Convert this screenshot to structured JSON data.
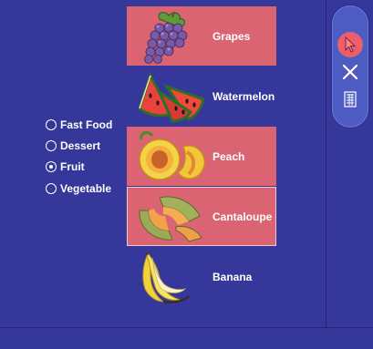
{
  "categories": [
    {
      "label": "Fast Food",
      "checked": false
    },
    {
      "label": "Dessert",
      "checked": false
    },
    {
      "label": "Fruit",
      "checked": true
    },
    {
      "label": "Vegetable",
      "checked": false
    }
  ],
  "items": [
    {
      "label": "Grapes",
      "icon": "grapes-icon",
      "highlighted": true
    },
    {
      "label": "Watermelon",
      "icon": "watermelon-icon",
      "highlighted": false
    },
    {
      "label": "Peach",
      "icon": "peach-icon",
      "highlighted": true
    },
    {
      "label": "Cantaloupe",
      "icon": "cantaloupe-icon",
      "highlighted": true,
      "selected": true
    },
    {
      "label": "Banana",
      "icon": "banana-icon",
      "highlighted": false
    }
  ],
  "toolbar": {
    "tools": [
      {
        "icon": "pointer-icon",
        "active": true
      },
      {
        "icon": "close-icon",
        "active": false
      },
      {
        "icon": "document-icon",
        "active": false
      }
    ]
  },
  "colors": {
    "background": "#35379a",
    "highlight": "#da6471",
    "toolbar": "#4d5cc2",
    "active_tool": "#ea5f6c"
  }
}
